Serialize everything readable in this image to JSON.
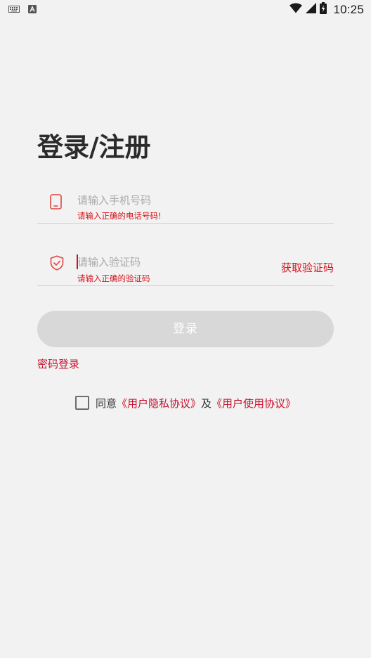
{
  "status_bar": {
    "time": "10:25",
    "icons": [
      "keyboard-icon",
      "a-badge-icon",
      "wifi-icon",
      "signal-icon",
      "battery-icon"
    ]
  },
  "login": {
    "title": "登录/注册",
    "phone": {
      "placeholder": "请输入手机号码",
      "value": "",
      "error": "请输入正确的电话号码!",
      "icon": "phone-icon"
    },
    "code": {
      "placeholder": "请输入验证码",
      "value": "",
      "error": "请输入正确的验证码",
      "icon": "shield-check-icon",
      "get_code_label": "获取验证码"
    },
    "submit_label": "登录",
    "password_login_label": "密码登录",
    "agreement": {
      "checked": false,
      "prefix": "同意",
      "privacy_link": "《用户隐私协议》",
      "conjunction": "及",
      "terms_link": "《用户使用协议》"
    }
  },
  "colors": {
    "accent": "#d7141b",
    "button_disabled": "#d8d8d8",
    "background": "#f2f2f2"
  }
}
